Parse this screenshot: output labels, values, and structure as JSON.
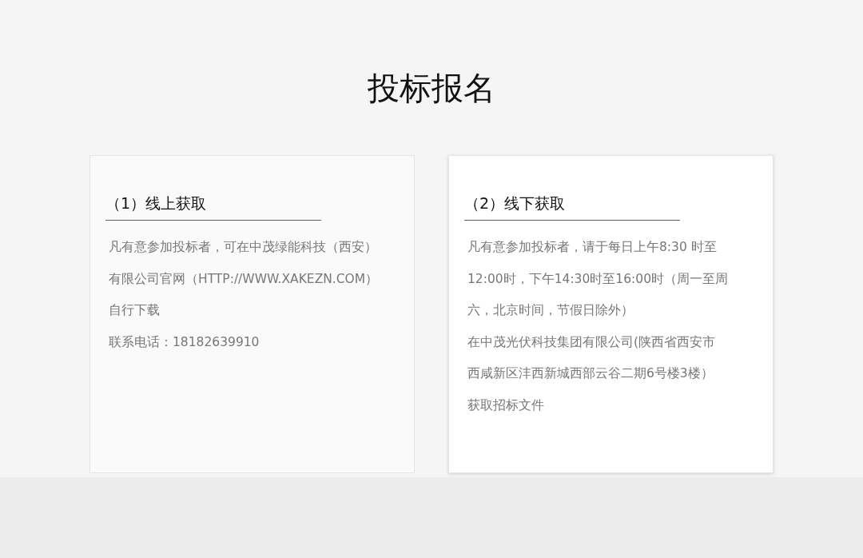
{
  "title": "投标报名",
  "cards": [
    {
      "heading": "（1）线上获取",
      "raised": false,
      "lines": [
        "凡有意参加投标者，可在中茂绿能科技（西安）",
        "有限公司官网（HTTP://WWW.XAKEZN.COM）",
        "自行下载",
        "联系电话：18182639910"
      ]
    },
    {
      "heading": "（2）线下获取",
      "raised": true,
      "lines": [
        "凡有意参加投标者，请于每日上午8:30 时至",
        "12:00时，下午14:30时至16:00时（周一至周",
        "六，北京时间，节假日除外）",
        "在中茂光伏科技集团有限公司(陕西省西安市",
        "西咸新区沣西新城西部云谷二期6号楼3楼）",
        "获取招标文件"
      ]
    }
  ]
}
